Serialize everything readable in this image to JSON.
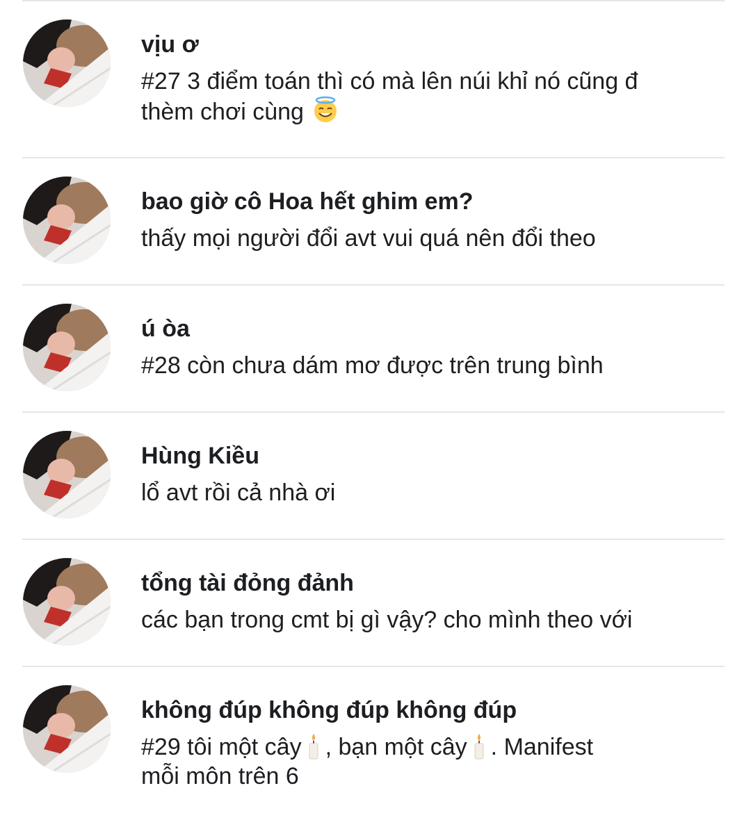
{
  "comments": [
    {
      "name": "vịu ơ",
      "line1": "#27 3 điểm toán thì có mà lên núi khỉ nó cũng đ",
      "line2": "thèm chơi cùng",
      "emoji": "smiling-face-with-halo"
    },
    {
      "name": "bao giờ cô Hoa hết ghim em?",
      "line1": "thấy mọi người đổi avt vui quá nên đổi theo"
    },
    {
      "name": "ú òa",
      "line1": "#28 còn chưa dám mơ được trên trung bình"
    },
    {
      "name": "Hùng Kiều",
      "line1": "lổ avt rồi cả nhà ơi"
    },
    {
      "name": "tổng tài đỏng đảnh",
      "line1": "các bạn trong cmt bị gì vậy? cho mình theo với"
    },
    {
      "name": "không đúp không đúp không đúp",
      "line1_a": "#29 tôi một cây",
      "line1_b": ", bạn một cây",
      "line1_c": ". Manifest",
      "line2": "mỗi môn trên 6",
      "emoji": "candle"
    }
  ]
}
